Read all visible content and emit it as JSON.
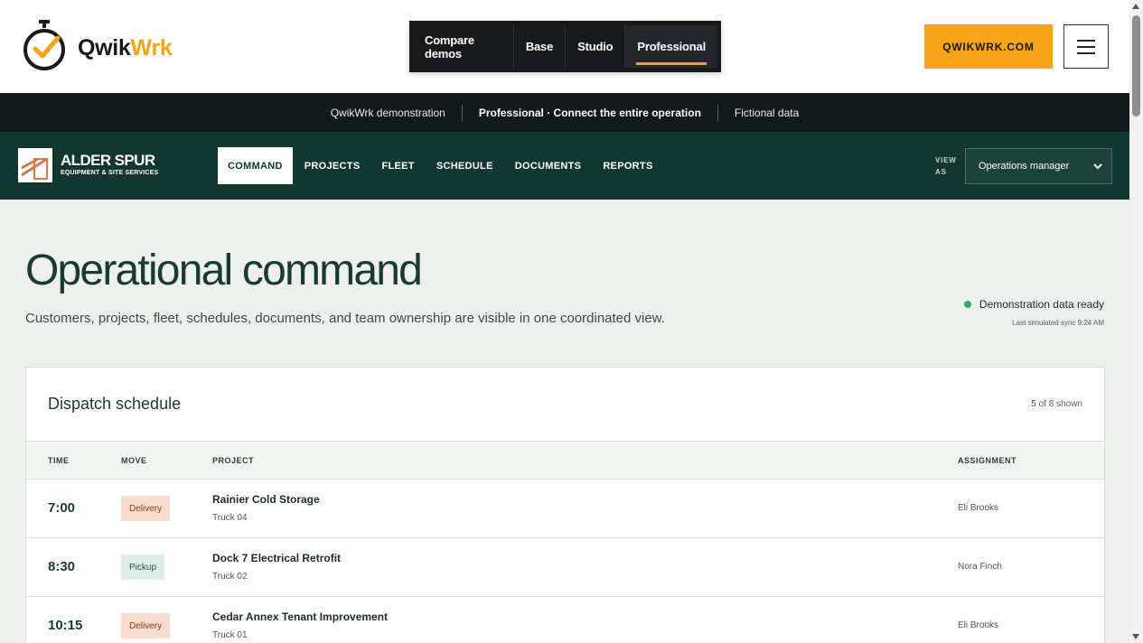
{
  "site": {
    "logo_text_a": "Qwik",
    "logo_text_b": "Wrk",
    "demo_tabs": [
      {
        "label": "Compare demos",
        "active": false
      },
      {
        "label": "Base",
        "active": false
      },
      {
        "label": "Studio",
        "active": false
      },
      {
        "label": "Professional",
        "active": true
      }
    ],
    "site_button": "QWIKWRK.COM",
    "menu_icon": "hamburger-icon",
    "accent_color": "#f7a516"
  },
  "infostrip": {
    "items": [
      "QwikWrk demonstration",
      "Professional · Connect the entire operation",
      "Fictional data"
    ]
  },
  "app": {
    "brand_name": "ALDER SPUR",
    "brand_tagline": "EQUIPMENT & SITE SERVICES",
    "nav_tabs": [
      "COMMAND",
      "PROJECTS",
      "FLEET",
      "SCHEDULE",
      "DOCUMENTS",
      "REPORTS"
    ],
    "view_as_label": "VIEW AS",
    "role_value": "Operations manager",
    "nav_color": "#123730"
  },
  "page": {
    "title": "Operational command",
    "subtitle": "Customers, projects, fleet, schedules, documents, and team ownership are visible in one coordinated view.",
    "status_text": "Demonstration data ready",
    "sync_text": "Last simulated sync 9:24 AM",
    "status_color": "#2fae67"
  },
  "dispatch": {
    "title": "Dispatch schedule",
    "count": "5 of 8 shown",
    "columns": {
      "time": "TIME",
      "move": "MOVE",
      "project": "PROJECT",
      "assignment": "ASSIGNMENT"
    },
    "rows": [
      {
        "time": "7:00",
        "move": "Delivery",
        "project": "Rainier Cold Storage",
        "truck": "Truck 04",
        "assignment": "Eli Brooks"
      },
      {
        "time": "8:30",
        "move": "Pickup",
        "project": "Dock 7 Electrical Retrofit",
        "truck": "Truck 02",
        "assignment": "Nora Finch"
      },
      {
        "time": "10:15",
        "move": "Delivery",
        "project": "Cedar Annex Tenant Improvement",
        "truck": "Truck 01",
        "assignment": "Eli Brooks"
      }
    ]
  }
}
